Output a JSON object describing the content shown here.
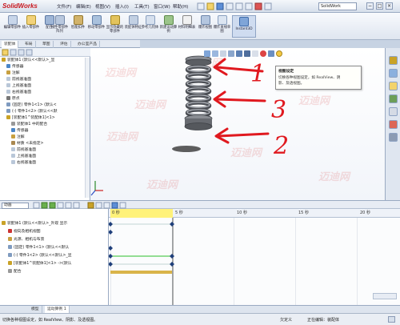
{
  "app": {
    "logo": "SolidWorks",
    "search": "SolidWork"
  },
  "menu": [
    "文件(F)",
    "编辑(E)",
    "视图(V)",
    "插入(I)",
    "工具(T)",
    "窗口(W)",
    "帮助(H)"
  ],
  "window_buttons": [
    "−",
    "□",
    "×"
  ],
  "toolbar": [
    {
      "label": "编辑零部件",
      "icon": "edit-component-icon"
    },
    {
      "label": "插入零部件",
      "icon": "insert-component-icon"
    },
    {
      "label": "配合",
      "icon": "mate-icon"
    },
    {
      "label": "线性零部件阵列",
      "icon": "linear-pattern-icon"
    },
    {
      "label": "智能扣件",
      "icon": "smart-fasteners-icon"
    },
    {
      "label": "移动零部件",
      "icon": "move-component-icon"
    },
    {
      "label": "显示隐藏的零部件",
      "icon": "show-hidden-icon"
    },
    {
      "label": "装配体特征",
      "icon": "assembly-feature-icon"
    },
    {
      "label": "参考几何体",
      "icon": "reference-geometry-icon"
    },
    {
      "label": "新建运动算例",
      "icon": "new-motion-study-icon"
    },
    {
      "label": "材料明细表",
      "icon": "bom-icon"
    },
    {
      "label": "爆炸视图",
      "icon": "exploded-view-icon"
    },
    {
      "label": "爆炸直线草图",
      "icon": "explode-line-sketch-icon"
    },
    {
      "label": "Instant3D",
      "icon": "instant3d-icon"
    }
  ],
  "tabs": [
    "装配体",
    "布局",
    "草图",
    "评估",
    "办公室产品"
  ],
  "tree": [
    {
      "text": "装配体1 (默认<<默认>_显",
      "color": "#c9a227"
    },
    {
      "text": "传感器",
      "color": "#4a86c8"
    },
    {
      "text": "注解",
      "color": "#c8a040"
    },
    {
      "text": "前视基准面",
      "color": "#b9c7d8"
    },
    {
      "text": "上视基准面",
      "color": "#b9c7d8"
    },
    {
      "text": "右视基准面",
      "color": "#b9c7d8"
    },
    {
      "text": "原点",
      "color": "#777"
    },
    {
      "text": "(固定) 零件1<1> (默认<",
      "color": "#7f9bc0"
    },
    {
      "text": "(-) 零件1<2> (默认<<默",
      "color": "#7f9bc0"
    },
    {
      "text": "[装配体1^装配体1]<1>",
      "color": "#c9a227"
    },
    {
      "text": "装配体1 中的配合",
      "color": "#999"
    },
    {
      "text": "传感器",
      "color": "#4a86c8"
    },
    {
      "text": "注解",
      "color": "#c8a040"
    },
    {
      "text": "材质 <未指定>",
      "color": "#a98850"
    },
    {
      "text": "前视基准面",
      "color": "#b9c7d8"
    },
    {
      "text": "上视基准面",
      "color": "#b9c7d8"
    },
    {
      "text": "右视基准面",
      "color": "#b9c7d8"
    }
  ],
  "tooltip": {
    "title": "视图设定",
    "desc_line1": "切换各种视图设定，如 RealView、阴",
    "desc_line2": "影、及透视图。"
  },
  "annotations": [
    "1",
    "3",
    "2"
  ],
  "watermark": "迈迪网",
  "motion": {
    "study_type": "动画",
    "tree": [
      {
        "text": "装配体1 (默认<<默认>_外观 显示",
        "color": "#c9a227"
      },
      {
        "text": "视向及相机视图",
        "color": "#cc3333"
      },
      {
        "text": "光源、相机与布景",
        "color": "#c8a040"
      },
      {
        "text": "(固定) 零件1<1> (默认<<默认",
        "color": "#7f9bc0"
      },
      {
        "text": "(-) 零件1<2> (默认<<默认>_显",
        "color": "#7f9bc0"
      },
      {
        "text": "[装配体1^装配体1]<1> ->(默认",
        "color": "#c9a227"
      },
      {
        "text": "配合",
        "color": "#999"
      }
    ],
    "ruler": [
      "0 秒",
      "5 秒",
      "10 秒",
      "15 秒",
      "20 秒"
    ]
  },
  "bottom_tabs": [
    "模型",
    "运动算例 1"
  ],
  "status": {
    "left": "切换各种视图设定，如 RealView、阴影、及透视图。",
    "center": "欠定义",
    "right": "正在编辑：装配体"
  }
}
